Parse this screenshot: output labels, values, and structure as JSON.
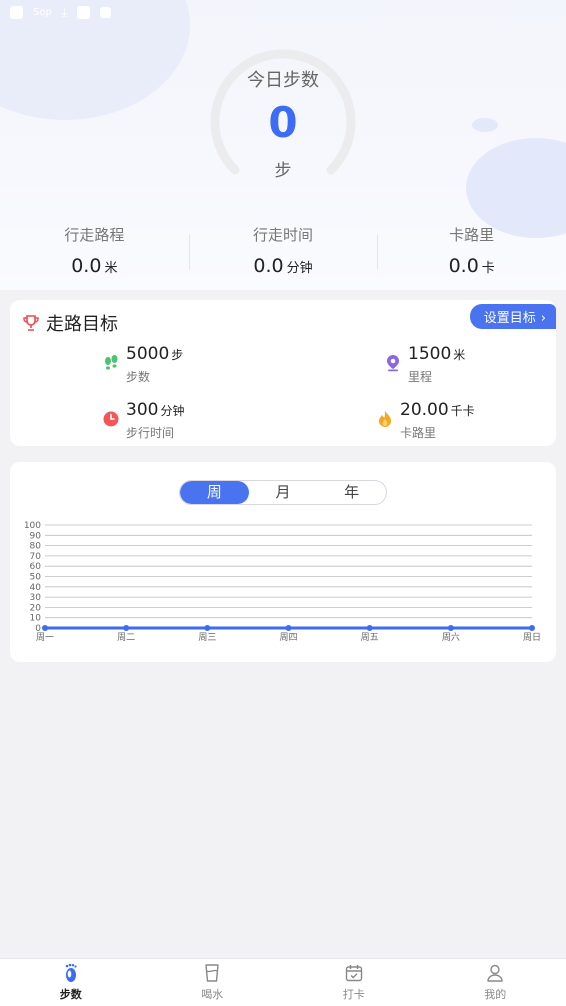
{
  "status_bar": {
    "speed": "Sop"
  },
  "today": {
    "label": "今日步数",
    "value": "0",
    "unit": "步"
  },
  "stats": [
    {
      "label": "行走路程",
      "value": "0.0",
      "unit": "米"
    },
    {
      "label": "行走时间",
      "value": "0.0",
      "unit": "分钟"
    },
    {
      "label": "卡路里",
      "value": "0.0",
      "unit": "卡"
    }
  ],
  "goal": {
    "title": "走路目标",
    "set_button": "设置目标",
    "items": [
      {
        "icon": "footprints-icon",
        "value": "5000",
        "unit": "步",
        "label": "步数",
        "color": "#4cc36e"
      },
      {
        "icon": "location-pin-icon",
        "value": "1500",
        "unit": "米",
        "label": "里程",
        "color": "#8a67e8"
      },
      {
        "icon": "clock-icon",
        "value": "300",
        "unit": "分钟",
        "label": "步行时间",
        "color": "#f25656"
      },
      {
        "icon": "flame-icon",
        "value": "20.00",
        "unit": "千卡",
        "label": "卡路里",
        "color": "#f5a623"
      }
    ]
  },
  "period_tabs": [
    {
      "label": "周",
      "active": true
    },
    {
      "label": "月",
      "active": false
    },
    {
      "label": "年",
      "active": false
    }
  ],
  "chart_data": {
    "type": "line",
    "categories": [
      "周一",
      "周二",
      "周三",
      "周四",
      "周五",
      "周六",
      "周日"
    ],
    "series": [
      {
        "values": [
          0,
          0,
          0,
          0,
          0,
          0,
          0
        ],
        "color": "#3b6cf3"
      }
    ],
    "ylim": [
      0,
      100
    ],
    "yticks": [
      0,
      10,
      20,
      30,
      40,
      50,
      60,
      70,
      80,
      90,
      100
    ],
    "grid": true
  },
  "tabbar": [
    {
      "label": "步数",
      "icon": "footprint-icon",
      "active": true
    },
    {
      "label": "喝水",
      "icon": "cup-icon",
      "active": false
    },
    {
      "label": "打卡",
      "icon": "calendar-check-icon",
      "active": false
    },
    {
      "label": "我的",
      "icon": "user-icon",
      "active": false
    }
  ]
}
